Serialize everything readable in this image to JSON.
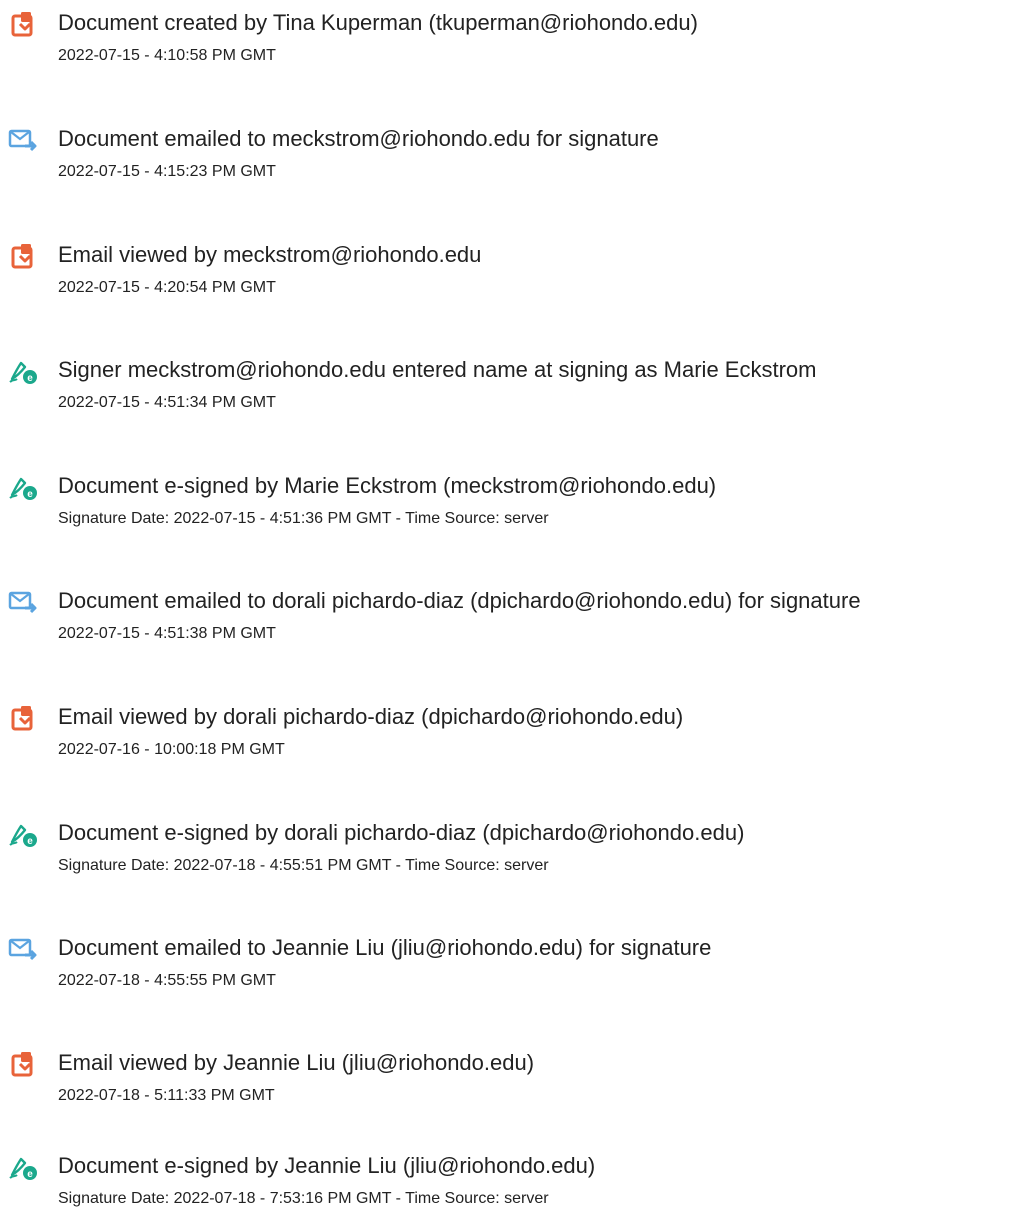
{
  "events": [
    {
      "type": "created",
      "icon": "document-created-icon",
      "title": "Document created by Tina Kuperman (tkuperman@riohondo.edu)",
      "meta": "2022-07-15 - 4:10:58 PM GMT"
    },
    {
      "type": "emailed",
      "icon": "email-sent-icon",
      "title": "Document emailed to meckstrom@riohondo.edu for signature",
      "meta": "2022-07-15 - 4:15:23 PM GMT"
    },
    {
      "type": "viewed",
      "icon": "document-viewed-icon",
      "title": "Email viewed by meckstrom@riohondo.edu",
      "meta": "2022-07-15 - 4:20:54 PM GMT"
    },
    {
      "type": "signed",
      "icon": "pen-signature-icon",
      "title": "Signer meckstrom@riohondo.edu entered name at signing as Marie Eckstrom",
      "meta": "2022-07-15 - 4:51:34 PM GMT"
    },
    {
      "type": "signed",
      "icon": "pen-signature-icon",
      "title": "Document e-signed by Marie Eckstrom (meckstrom@riohondo.edu)",
      "meta": "Signature Date: 2022-07-15 - 4:51:36 PM GMT - Time Source: server"
    },
    {
      "type": "emailed",
      "icon": "email-sent-icon",
      "title": "Document emailed to dorali pichardo-diaz (dpichardo@riohondo.edu) for signature",
      "meta": "2022-07-15 - 4:51:38 PM GMT"
    },
    {
      "type": "viewed",
      "icon": "document-viewed-icon",
      "title": "Email viewed by dorali pichardo-diaz (dpichardo@riohondo.edu)",
      "meta": "2022-07-16 - 10:00:18 PM GMT"
    },
    {
      "type": "signed",
      "icon": "pen-signature-icon",
      "title": "Document e-signed by dorali pichardo-diaz (dpichardo@riohondo.edu)",
      "meta": "Signature Date: 2022-07-18 - 4:55:51 PM GMT - Time Source: server"
    },
    {
      "type": "emailed",
      "icon": "email-sent-icon",
      "title": "Document emailed to Jeannie Liu (jliu@riohondo.edu) for signature",
      "meta": "2022-07-18 - 4:55:55 PM GMT"
    },
    {
      "type": "viewed",
      "icon": "document-viewed-icon",
      "title": "Email viewed by Jeannie Liu (jliu@riohondo.edu)",
      "meta": "2022-07-18 - 5:11:33 PM GMT"
    },
    {
      "type": "signed",
      "icon": "pen-signature-icon",
      "title": "Document e-signed by Jeannie Liu (jliu@riohondo.edu)",
      "meta": "Signature Date: 2022-07-18 - 7:53:16 PM GMT - Time Source: server"
    }
  ],
  "colors": {
    "document_icon": "#E8633A",
    "email_icon": "#5BA4E0",
    "sign_icon": "#1BA88C",
    "text": "#222222"
  }
}
